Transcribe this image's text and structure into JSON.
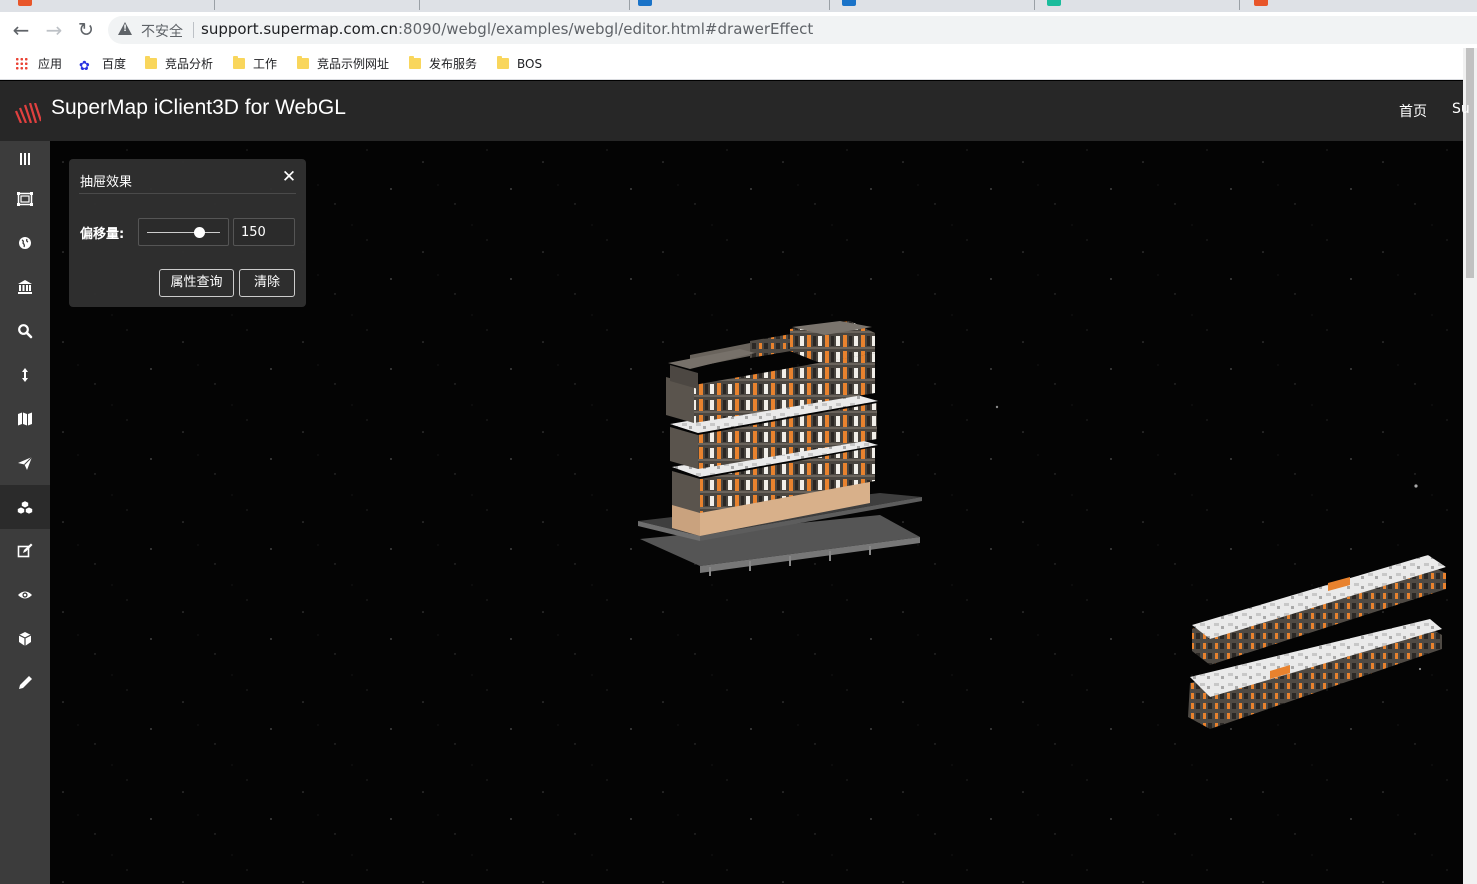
{
  "browser": {
    "security_label": "不安全",
    "url_host": "support.supermap.com.cn",
    "url_rest": ":8090/webgl/examples/webgl/editor.html#drawerEffect"
  },
  "bookmarks": [
    {
      "label": "应用",
      "icon": "apps-grid-icon"
    },
    {
      "label": "百度",
      "icon": "baidu-paw-icon"
    },
    {
      "label": "竞品分析",
      "icon": "folder-icon"
    },
    {
      "label": "工作",
      "icon": "folder-icon"
    },
    {
      "label": "竞品示例网址",
      "icon": "folder-icon"
    },
    {
      "label": "发布服务",
      "icon": "folder-icon"
    },
    {
      "label": "BOS",
      "icon": "folder-icon"
    }
  ],
  "app": {
    "title": "SuperMap iClient3D for WebGL",
    "nav": [
      "首页",
      "Su"
    ]
  },
  "sidebar": [
    {
      "name": "menu-toggle",
      "icon": "bars-icon"
    },
    {
      "name": "layers",
      "icon": "image-frame-icon"
    },
    {
      "name": "globe",
      "icon": "globe-icon"
    },
    {
      "name": "buildings",
      "icon": "institution-icon"
    },
    {
      "name": "search",
      "icon": "search-icon"
    },
    {
      "name": "height",
      "icon": "vertical-arrows-icon"
    },
    {
      "name": "map",
      "icon": "map-icon"
    },
    {
      "name": "fly",
      "icon": "paper-plane-icon"
    },
    {
      "name": "analysis",
      "icon": "cubes-icon"
    },
    {
      "name": "edit",
      "icon": "edit-icon"
    },
    {
      "name": "visibility",
      "icon": "eye-icon"
    },
    {
      "name": "model",
      "icon": "cube-icon"
    },
    {
      "name": "draw",
      "icon": "pencil-icon"
    }
  ],
  "panel": {
    "title": "抽屉效果",
    "offset_label": "偏移量:",
    "offset_value": "150",
    "slider_fraction": 0.72,
    "query_button": "属性查询",
    "clear_button": "清除"
  },
  "colors": {
    "header_bg": "#272727",
    "sidebar_bg": "#3c3c3c",
    "scene_bg": "#040404",
    "accent_orange": "#e8822e",
    "logo_red": "#e0403f"
  }
}
